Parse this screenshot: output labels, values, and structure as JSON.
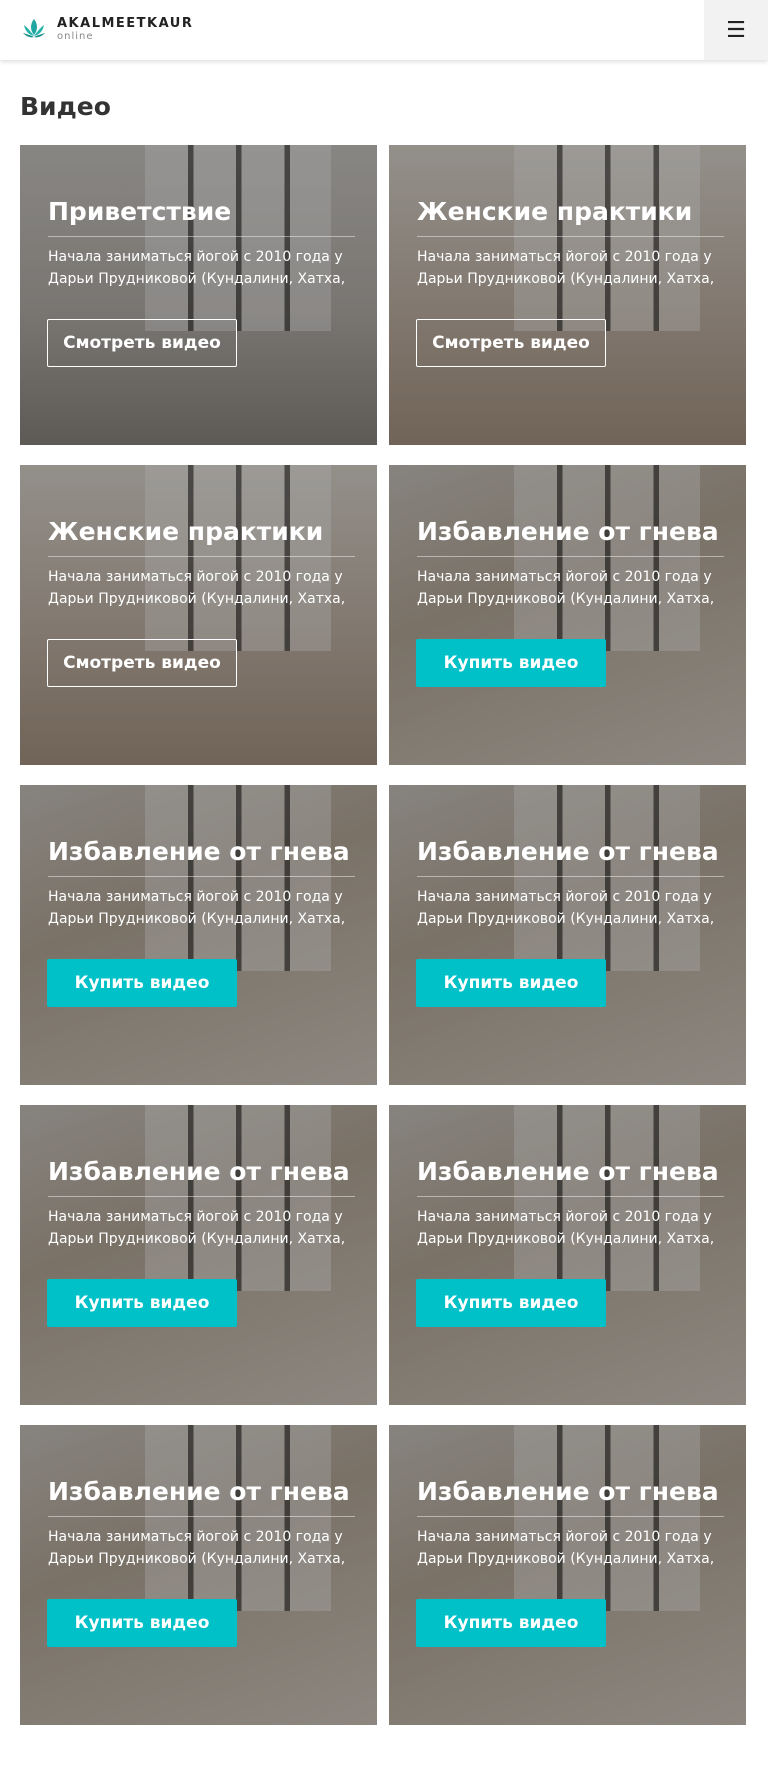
{
  "header": {
    "brand": "AKALMEETKAUR",
    "brand_sub": "online",
    "menu_icon": "☰"
  },
  "page_title": "Видео",
  "colors": {
    "accent": "#00c1c7"
  },
  "cards": [
    {
      "theme": "room",
      "title": "Приветствие",
      "desc": "Начала заниматься йогой с 2010 года у Дарьи  Прудниковой (Кундалини, Хатха,",
      "button": "Смотреть видео",
      "style": "outline"
    },
    {
      "theme": "yoga",
      "title": "Женские практики",
      "desc": "Начала заниматься йогой с 2010 года у Дарьи  Прудниковой (Кундалини, Хатха,",
      "button": "Смотреть видео",
      "style": "outline"
    },
    {
      "theme": "yoga",
      "title": "Женские практики",
      "desc": "Начала заниматься йогой с 2010 года у Дарьи  Прудниковой (Кундалини, Хатха,",
      "button": "Смотреть видео",
      "style": "outline"
    },
    {
      "theme": "anger",
      "title": "Избавление от гнева",
      "desc": "Начала заниматься йогой с 2010 года у Дарьи  Прудниковой (Кундалини, Хатха,",
      "button": "Купить видео",
      "style": "filled"
    },
    {
      "theme": "anger",
      "title": "Избавление от гнева",
      "desc": "Начала заниматься йогой с 2010 года у Дарьи  Прудниковой (Кундалини, Хатха,",
      "button": "Купить видео",
      "style": "filled"
    },
    {
      "theme": "anger",
      "title": "Избавление от гнева",
      "desc": "Начала заниматься йогой с 2010 года у Дарьи  Прудниковой (Кундалини, Хатха,",
      "button": "Купить видео",
      "style": "filled"
    },
    {
      "theme": "anger",
      "title": "Избавление от гнева",
      "desc": "Начала заниматься йогой с 2010 года у Дарьи  Прудниковой (Кундалини, Хатха,",
      "button": "Купить видео",
      "style": "filled"
    },
    {
      "theme": "anger",
      "title": "Избавление от гнева",
      "desc": "Начала заниматься йогой с 2010 года у Дарьи  Прудниковой (Кундалини, Хатха,",
      "button": "Купить видео",
      "style": "filled"
    },
    {
      "theme": "anger",
      "title": "Избавление от гнева",
      "desc": "Начала заниматься йогой с 2010 года у Дарьи  Прудниковой (Кундалини, Хатха,",
      "button": "Купить видео",
      "style": "filled"
    },
    {
      "theme": "anger",
      "title": "Избавление от гнева",
      "desc": "Начала заниматься йогой с 2010 года у Дарьи  Прудниковой (Кундалини, Хатха,",
      "button": "Купить видео",
      "style": "filled"
    }
  ]
}
